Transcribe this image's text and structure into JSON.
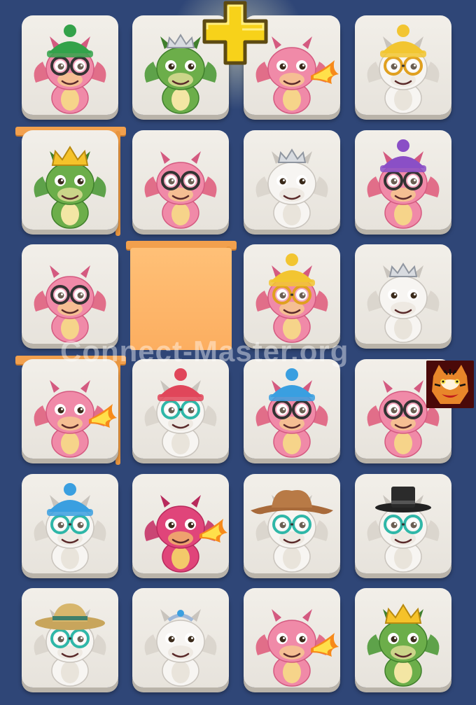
{
  "game": {
    "title": "Connect-Master",
    "watermark": "Connect-Master.org",
    "hint_icon": "plus-icon",
    "logo_icon": "tiger-logo-icon"
  },
  "colors": {
    "background": "#2f4677",
    "tile_face": "#efebe5",
    "tile_shadow": "#b9b3a9",
    "empty_cell": "#fcae60",
    "plus": "#f7d21a"
  },
  "grid": {
    "rows": 6,
    "cols": 4,
    "tiles": [
      {
        "row": 0,
        "col": 0,
        "dragon": "pink",
        "accessory": "green beanie",
        "glasses": true,
        "fire": false
      },
      {
        "row": 0,
        "col": 1,
        "dragon": "green",
        "accessory": "silver crown",
        "glasses": false,
        "fire": false
      },
      {
        "row": 0,
        "col": 2,
        "dragon": "pink",
        "accessory": "none",
        "glasses": false,
        "fire": true
      },
      {
        "row": 0,
        "col": 3,
        "dragon": "white",
        "accessory": "yellow beanie",
        "glasses": true,
        "fire": false
      },
      {
        "row": 1,
        "col": 0,
        "dragon": "green",
        "accessory": "gold crown",
        "glasses": false,
        "fire": false
      },
      {
        "row": 1,
        "col": 1,
        "dragon": "pink",
        "accessory": "none",
        "glasses": true,
        "fire": false
      },
      {
        "row": 1,
        "col": 2,
        "dragon": "white",
        "accessory": "silver crown",
        "glasses": false,
        "fire": false
      },
      {
        "row": 1,
        "col": 3,
        "dragon": "pink",
        "accessory": "purple beanie",
        "glasses": true,
        "fire": false
      },
      {
        "row": 2,
        "col": 0,
        "dragon": "pink",
        "accessory": "none",
        "glasses": true,
        "fire": false
      },
      {
        "row": 2,
        "col": 1,
        "dragon": "empty",
        "accessory": "none",
        "glasses": false,
        "fire": false
      },
      {
        "row": 2,
        "col": 2,
        "dragon": "pink",
        "accessory": "yellow beanie",
        "glasses": true,
        "fire": false
      },
      {
        "row": 2,
        "col": 3,
        "dragon": "white",
        "accessory": "silver crown",
        "glasses": false,
        "fire": false
      },
      {
        "row": 3,
        "col": 0,
        "dragon": "pink",
        "accessory": "none",
        "glasses": false,
        "fire": true
      },
      {
        "row": 3,
        "col": 1,
        "dragon": "white",
        "accessory": "red beanie",
        "glasses": true,
        "fire": false
      },
      {
        "row": 3,
        "col": 2,
        "dragon": "pink",
        "accessory": "blue beanie",
        "glasses": true,
        "fire": false
      },
      {
        "row": 3,
        "col": 3,
        "dragon": "pink",
        "accessory": "none",
        "glasses": true,
        "fire": false
      },
      {
        "row": 4,
        "col": 0,
        "dragon": "white",
        "accessory": "blue beanie",
        "glasses": true,
        "fire": false
      },
      {
        "row": 4,
        "col": 1,
        "dragon": "magenta",
        "accessory": "none",
        "glasses": false,
        "fire": true
      },
      {
        "row": 4,
        "col": 2,
        "dragon": "white",
        "accessory": "brown cowboy hat",
        "glasses": true,
        "fire": false
      },
      {
        "row": 4,
        "col": 3,
        "dragon": "white",
        "accessory": "black top hat",
        "glasses": true,
        "fire": false
      },
      {
        "row": 5,
        "col": 0,
        "dragon": "white",
        "accessory": "straw sun hat",
        "glasses": true,
        "fire": false
      },
      {
        "row": 5,
        "col": 1,
        "dragon": "white",
        "accessory": "blue tiara",
        "glasses": false,
        "fire": false
      },
      {
        "row": 5,
        "col": 2,
        "dragon": "pink",
        "accessory": "none",
        "glasses": false,
        "fire": true
      },
      {
        "row": 5,
        "col": 3,
        "dragon": "green",
        "accessory": "gold crown",
        "glasses": false,
        "fire": false
      }
    ]
  }
}
